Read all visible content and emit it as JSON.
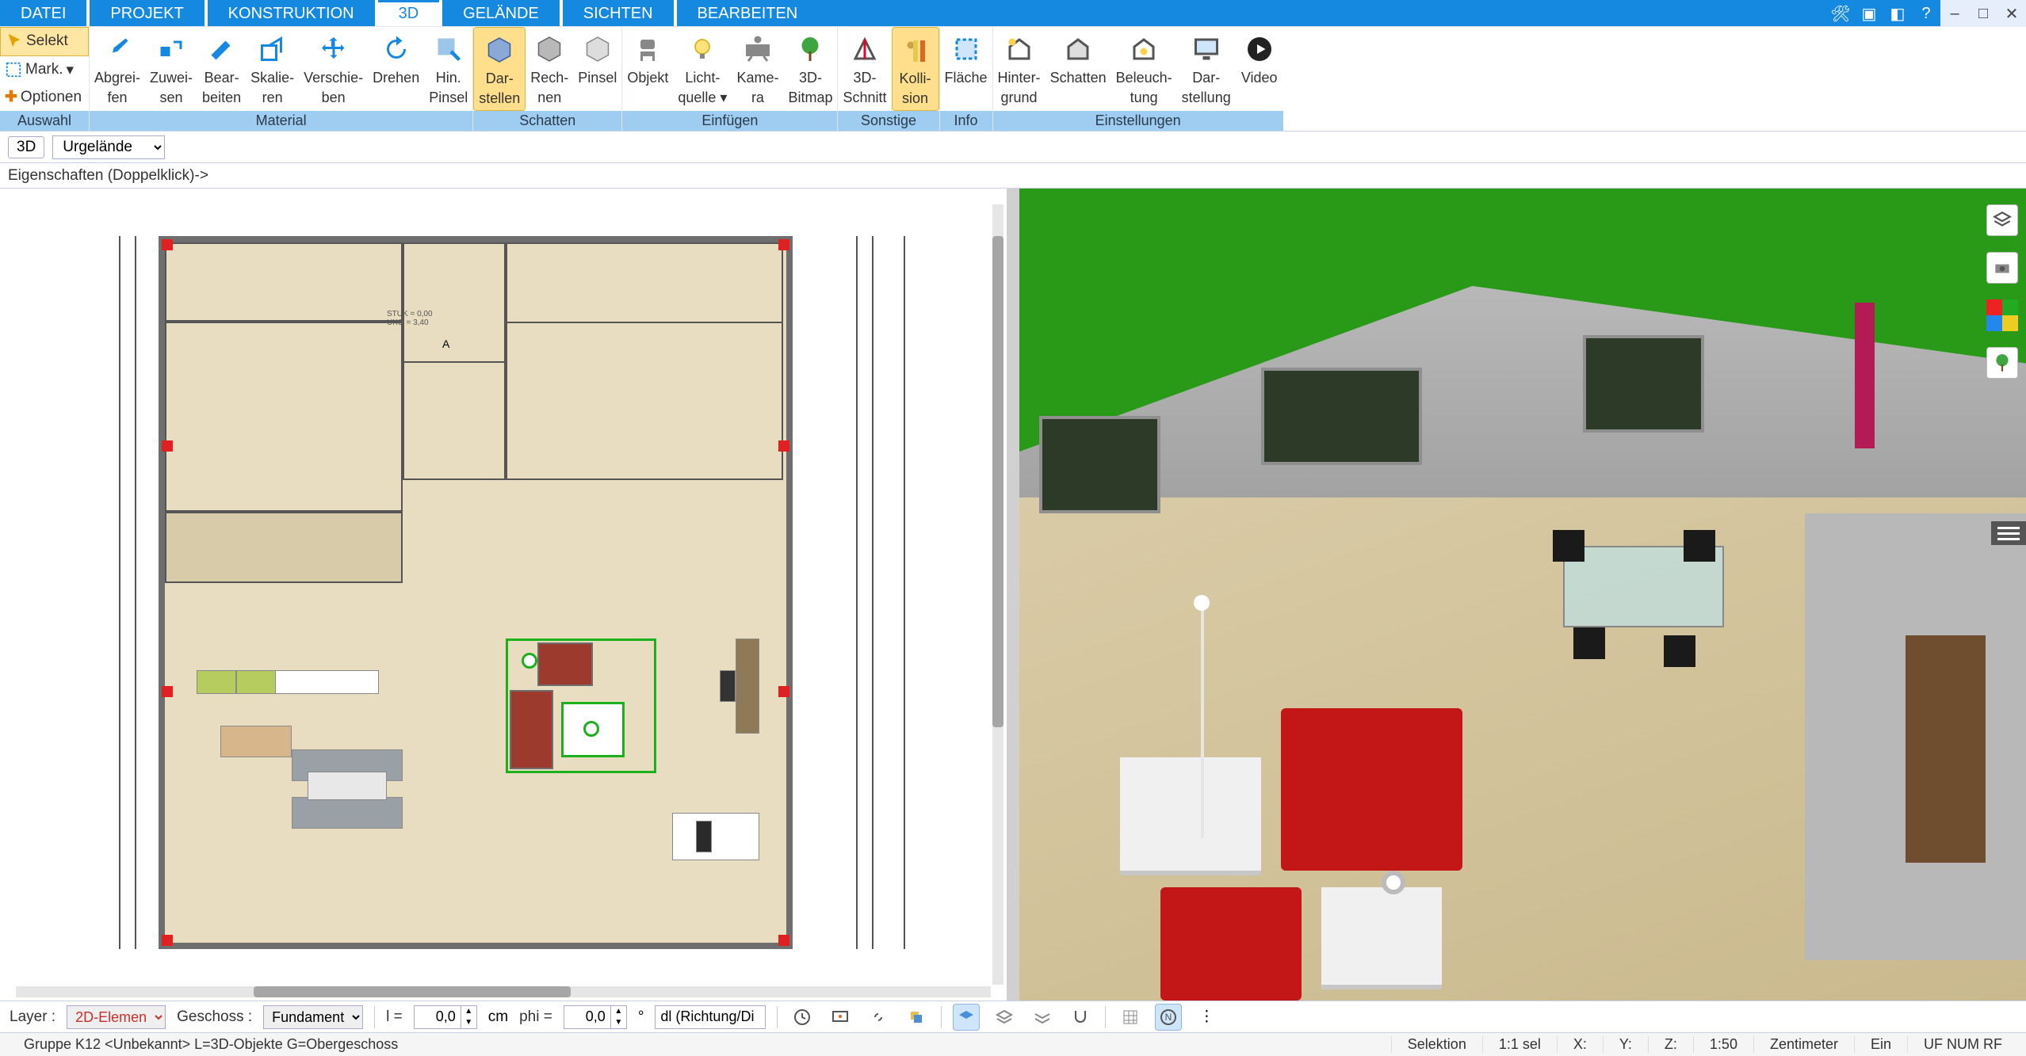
{
  "menu": {
    "tabs": [
      "DATEI",
      "PROJEKT",
      "KONSTRUKTION",
      "3D",
      "GELÄNDE",
      "SICHTEN",
      "BEARBEITEN"
    ],
    "active_index": 3
  },
  "ribbon": {
    "side": {
      "select": "Selekt",
      "mark": "Mark.",
      "options": "Optionen",
      "group_label": "Auswahl"
    },
    "groups": [
      {
        "label": "Material",
        "buttons": [
          {
            "name": "abgreifen",
            "line1": "Abgrei-",
            "line2": "fen",
            "icon": "eyedrop"
          },
          {
            "name": "zuweisen",
            "line1": "Zuwei-",
            "line2": "sen",
            "icon": "assign"
          },
          {
            "name": "bearbeiten",
            "line1": "Bear-",
            "line2": "beiten",
            "icon": "edit"
          },
          {
            "name": "skalieren",
            "line1": "Skalie-",
            "line2": "ren",
            "icon": "scale"
          },
          {
            "name": "verschieben",
            "line1": "Verschie-",
            "line2": "ben",
            "icon": "move"
          },
          {
            "name": "drehen",
            "line1": "Drehen",
            "line2": "",
            "icon": "rotate"
          },
          {
            "name": "hinpinsel",
            "line1": "Hin.",
            "line2": "Pinsel",
            "icon": "brush"
          }
        ]
      },
      {
        "label": "Schatten",
        "buttons": [
          {
            "name": "darstellen",
            "line1": "Dar-",
            "line2": "stellen",
            "icon": "cube",
            "active": true
          },
          {
            "name": "rechnen",
            "line1": "Rech-",
            "line2": "nen",
            "icon": "cube2"
          },
          {
            "name": "pinsel",
            "line1": "Pinsel",
            "line2": "",
            "icon": "cube3"
          }
        ]
      },
      {
        "label": "Einfügen",
        "buttons": [
          {
            "name": "objekt",
            "line1": "Objekt",
            "line2": "",
            "icon": "chair"
          },
          {
            "name": "lichtquelle",
            "line1": "Licht-",
            "line2": "quelle ▾",
            "icon": "bulb"
          },
          {
            "name": "kamera",
            "line1": "Kame-",
            "line2": "ra",
            "icon": "camera"
          },
          {
            "name": "bitmap3d",
            "line1": "3D-",
            "line2": "Bitmap",
            "icon": "tree"
          }
        ]
      },
      {
        "label": "Sonstige",
        "buttons": [
          {
            "name": "schnitt3d",
            "line1": "3D-",
            "line2": "Schnitt",
            "icon": "section"
          },
          {
            "name": "kollision",
            "line1": "Kolli-",
            "line2": "sion",
            "icon": "collision",
            "active": true
          }
        ]
      },
      {
        "label": "Info",
        "buttons": [
          {
            "name": "flaeche",
            "line1": "Fläche",
            "line2": "",
            "icon": "area"
          }
        ]
      },
      {
        "label": "Einstellungen",
        "buttons": [
          {
            "name": "hintergrund",
            "line1": "Hinter-",
            "line2": "grund",
            "icon": "house"
          },
          {
            "name": "schatten-e",
            "line1": "Schatten",
            "line2": "",
            "icon": "house2"
          },
          {
            "name": "beleuchtung",
            "line1": "Beleuch-",
            "line2": "tung",
            "icon": "house3"
          },
          {
            "name": "darstellung",
            "line1": "Dar-",
            "line2": "stellung",
            "icon": "monitor"
          },
          {
            "name": "video",
            "line1": "Video",
            "line2": "",
            "icon": "play"
          }
        ]
      }
    ]
  },
  "contextbar": {
    "mode": "3D",
    "terrain": "Urgelände"
  },
  "properties_hint": "Eigenschaften (Doppelklick)->",
  "plan2d": {
    "annotations": {
      "a_label": "A",
      "stuk_text": "STUK = 0,00",
      "uko_text": "UKO = 3,40"
    }
  },
  "bottombar": {
    "layer_label": "Layer :",
    "layer_value": "2D-Elemen",
    "geschoss_label": "Geschoss :",
    "geschoss_value": "Fundament",
    "l_label": "l =",
    "l_value": "0,0",
    "unit_cm": "cm",
    "phi_label": "phi =",
    "phi_value": "0,0",
    "unit_deg": "°",
    "dl_value": "dl (Richtung/Di"
  },
  "statusbar": {
    "left": "Gruppe K12  <Unbekannt>  L=3D-Objekte G=Obergeschoss",
    "mode": "Selektion",
    "sel": "1:1 sel",
    "x_label": "X:",
    "y_label": "Y:",
    "z_label": "Z:",
    "scale": "1:50",
    "unit": "Zentimeter",
    "snap": "Ein",
    "indicators": "UF  NUM  RF"
  }
}
